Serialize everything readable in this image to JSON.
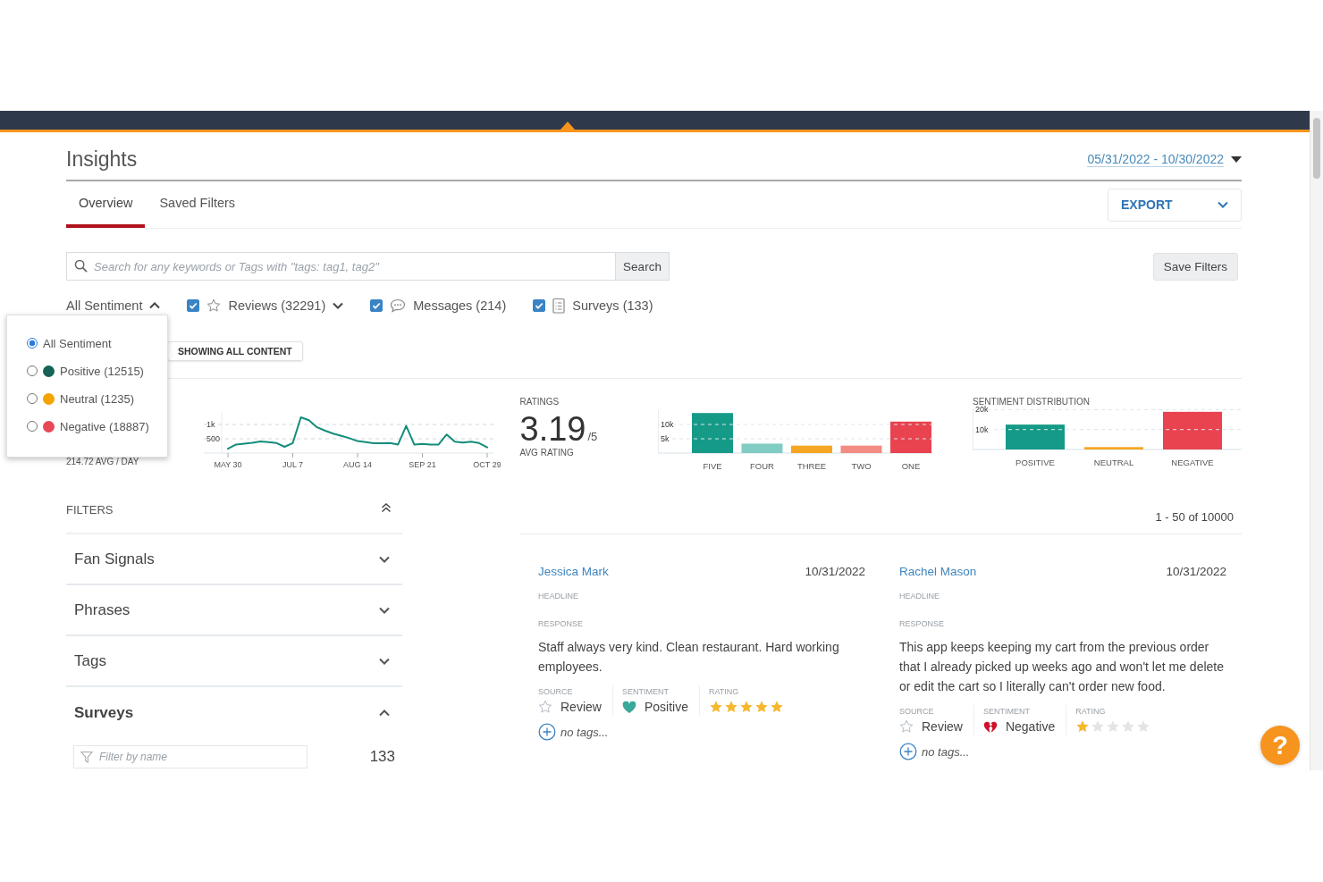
{
  "page": {
    "title": "Insights",
    "date_range": "05/31/2022 - 10/30/2022"
  },
  "tabs": [
    {
      "label": "Overview",
      "selected": true
    },
    {
      "label": "Saved Filters",
      "selected": false
    }
  ],
  "export_button": "EXPORT",
  "search": {
    "placeholder": "Search for any keywords or Tags with \"tags: tag1, tag2\"",
    "button": "Search"
  },
  "save_filters_button": "Save Filters",
  "sentiment_filter": {
    "label": "All Sentiment",
    "expanded": true,
    "options": [
      {
        "label": "All Sentiment",
        "selected": true
      },
      {
        "label": "Positive (12515)",
        "selected": false,
        "color": "#146356"
      },
      {
        "label": "Neutral (1235)",
        "selected": false,
        "color": "#f5a300"
      },
      {
        "label": "Negative (18887)",
        "selected": false,
        "color": "#e84855"
      }
    ]
  },
  "content_types": [
    {
      "kind": "reviews",
      "label": "Reviews (32291)",
      "checked": true,
      "dropdown": true
    },
    {
      "kind": "messages",
      "label": "Messages (214)",
      "checked": true,
      "dropdown": false
    },
    {
      "kind": "surveys",
      "label": "Surveys (133)",
      "checked": true,
      "dropdown": false
    }
  ],
  "content_badge": "SHOWING ALL CONTENT",
  "volume": {
    "average": "214.72 AVG / DAY",
    "chart_data": {
      "type": "line",
      "categories": [
        "MAY 30",
        null,
        null,
        null,
        null,
        null,
        null,
        null,
        "JUL 7",
        null,
        null,
        null,
        null,
        null,
        null,
        null,
        "AUG 14",
        null,
        null,
        null,
        null,
        null,
        null,
        null,
        "SEP 21",
        null,
        null,
        null,
        null,
        null,
        null,
        null,
        "OCT 29"
      ],
      "series": [
        {
          "color": "#138c7a",
          "values": [
            150,
            300,
            330,
            360,
            410,
            380,
            350,
            220,
            350,
            1250,
            1150,
            900,
            780,
            680,
            600,
            520,
            420,
            380,
            340,
            340,
            350,
            300,
            950,
            300,
            320,
            300,
            300,
            650,
            400,
            370,
            400,
            350,
            200
          ]
        }
      ],
      "ylim": [
        0,
        1400
      ],
      "yticks": [
        {
          "value": 500,
          "label": "500"
        },
        {
          "value": 1000,
          "label": "1k"
        }
      ]
    }
  },
  "ratings": {
    "title": "RATINGS",
    "average": "3.19",
    "scale": "/5",
    "caption": "AVG RATING",
    "chart_data": {
      "type": "bar",
      "categories": [
        "FIVE",
        "FOUR",
        "THREE",
        "TWO",
        "ONE"
      ],
      "values": [
        14000,
        3300,
        2600,
        2600,
        11000
      ],
      "colors": [
        "#169a88",
        "#82cdc3",
        "#f5a623",
        "#f28b82",
        "#e8434f"
      ],
      "ylim": [
        0,
        15000
      ],
      "yticks": [
        {
          "value": 5000,
          "label": "5k"
        },
        {
          "value": 10000,
          "label": "10k"
        }
      ]
    }
  },
  "sentiment_distribution": {
    "chart_data": {
      "type": "bar",
      "title": "SENTIMENT DISTRIBUTION",
      "categories": [
        "POSITIVE",
        "NEUTRAL",
        "NEGATIVE"
      ],
      "values": [
        12500,
        1200,
        18900
      ],
      "colors": [
        "#169a88",
        "#f5a623",
        "#e8434f"
      ],
      "ylim": [
        0,
        20000
      ],
      "yticks": [
        {
          "value": 10000,
          "label": "10k"
        },
        {
          "value": 20000,
          "label": "20k"
        }
      ]
    }
  },
  "filters": {
    "title": "FILTERS",
    "sections": [
      {
        "label": "Fan Signals",
        "expanded": false
      },
      {
        "label": "Phrases",
        "expanded": false
      },
      {
        "label": "Tags",
        "expanded": false
      },
      {
        "label": "Surveys",
        "expanded": true
      }
    ],
    "search_placeholder": "Filter by name",
    "count": "133"
  },
  "results": {
    "range": "1 - 50 of 10000",
    "reviews": [
      {
        "name": "Jessica Mark",
        "date": "10/31/2022",
        "headline_label": "HEADLINE",
        "response_label": "RESPONSE",
        "response": "Staff always very kind. Clean restaurant. Hard working employees.",
        "source_label": "SOURCE",
        "source": "Review",
        "sentiment_label": "SENTIMENT",
        "kind": "positive",
        "sentiment": "Positive",
        "rating_label": "RATING",
        "stars": 5,
        "tags": "no tags..."
      },
      {
        "name": "Rachel Mason",
        "date": "10/31/2022",
        "headline_label": "HEADLINE",
        "response_label": "RESPONSE",
        "response": "This app keeps keeping my cart from the previous order that I already picked up weeks ago and won't let me delete or edit the cart so I literally can't order new food.",
        "source_label": "SOURCE",
        "source": "Review",
        "sentiment_label": "SENTIMENT",
        "kind": "negative",
        "sentiment": "Negative",
        "rating_label": "RATING",
        "stars": 1,
        "tags": "no tags..."
      }
    ]
  },
  "help_button": "?"
}
